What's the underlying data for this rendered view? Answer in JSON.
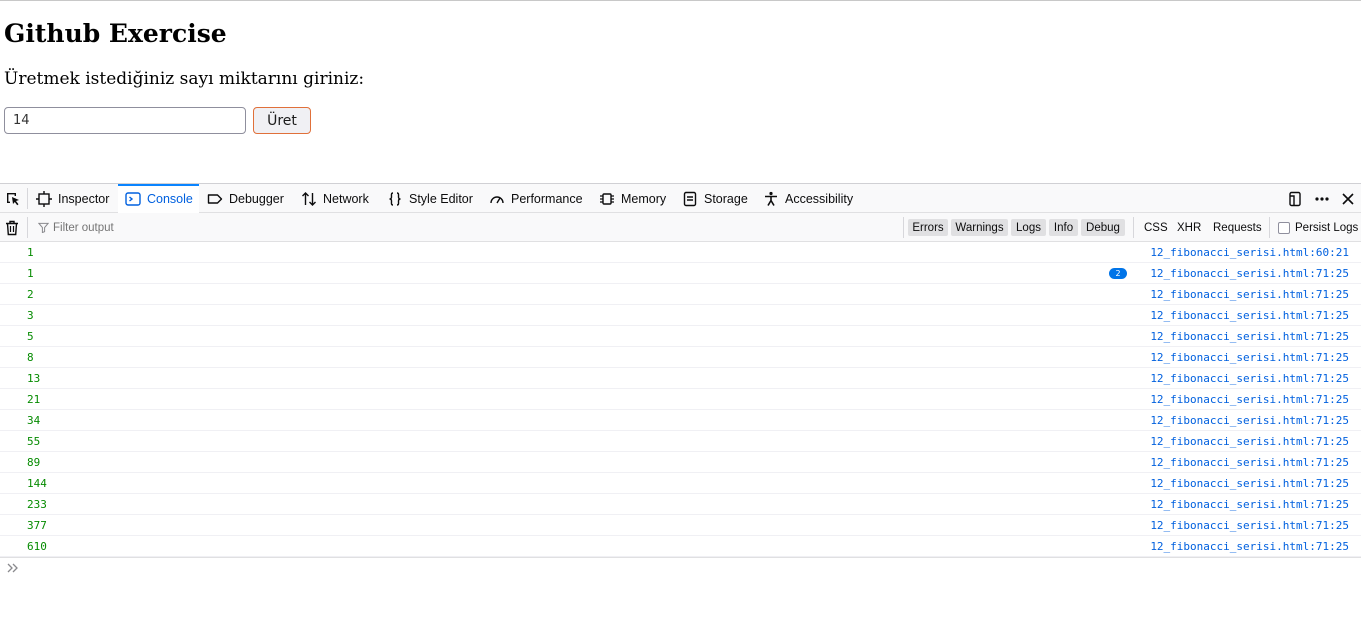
{
  "page": {
    "heading": "Github Exercise",
    "prompt": "Üretmek istediğiniz sayı miktarını giriniz:",
    "input_value": "14",
    "button_label": "Üret"
  },
  "devtools": {
    "tabs": [
      {
        "label": "Inspector",
        "icon": "inspector-icon"
      },
      {
        "label": "Console",
        "icon": "console-icon",
        "active": true
      },
      {
        "label": "Debugger",
        "icon": "debugger-icon"
      },
      {
        "label": "Network",
        "icon": "network-icon"
      },
      {
        "label": "Style Editor",
        "icon": "style-editor-icon"
      },
      {
        "label": "Performance",
        "icon": "performance-icon"
      },
      {
        "label": "Memory",
        "icon": "memory-icon"
      },
      {
        "label": "Storage",
        "icon": "storage-icon"
      },
      {
        "label": "Accessibility",
        "icon": "accessibility-icon"
      }
    ],
    "filter_placeholder": "Filter output",
    "levels": [
      "Errors",
      "Warnings",
      "Logs",
      "Info",
      "Debug"
    ],
    "request_filters": [
      "CSS",
      "XHR",
      "Requests"
    ],
    "persist_logs_label": "Persist Logs",
    "accent_color": "#0a84ff",
    "log_value_color": "#058b00",
    "source_link_color": "#0060df",
    "messages": [
      {
        "value": "1",
        "source": "12_fibonacci_serisi.html:60:21"
      },
      {
        "value": "1",
        "source": "12_fibonacci_serisi.html:71:25",
        "repeat": "2"
      },
      {
        "value": "2",
        "source": "12_fibonacci_serisi.html:71:25"
      },
      {
        "value": "3",
        "source": "12_fibonacci_serisi.html:71:25"
      },
      {
        "value": "5",
        "source": "12_fibonacci_serisi.html:71:25"
      },
      {
        "value": "8",
        "source": "12_fibonacci_serisi.html:71:25"
      },
      {
        "value": "13",
        "source": "12_fibonacci_serisi.html:71:25"
      },
      {
        "value": "21",
        "source": "12_fibonacci_serisi.html:71:25"
      },
      {
        "value": "34",
        "source": "12_fibonacci_serisi.html:71:25"
      },
      {
        "value": "55",
        "source": "12_fibonacci_serisi.html:71:25"
      },
      {
        "value": "89",
        "source": "12_fibonacci_serisi.html:71:25"
      },
      {
        "value": "144",
        "source": "12_fibonacci_serisi.html:71:25"
      },
      {
        "value": "233",
        "source": "12_fibonacci_serisi.html:71:25"
      },
      {
        "value": "377",
        "source": "12_fibonacci_serisi.html:71:25"
      },
      {
        "value": "610",
        "source": "12_fibonacci_serisi.html:71:25"
      }
    ]
  }
}
